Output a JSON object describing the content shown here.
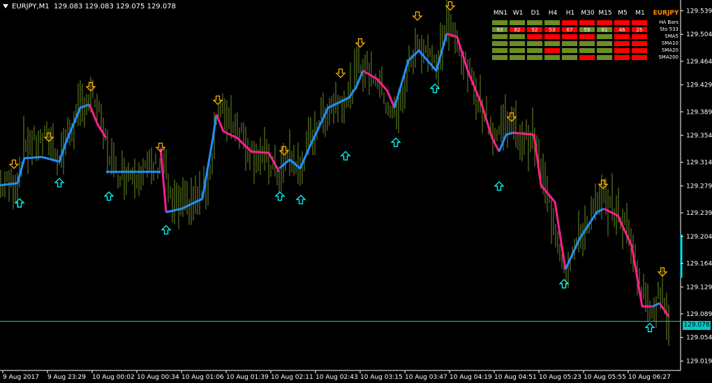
{
  "header": {
    "symbol": "EURJPY,M1",
    "ohlc": "129.083 129.083 129.075 129.078"
  },
  "current_price": "129.078",
  "colors": {
    "background": "#000000",
    "axis": "#ffffff",
    "bars": "#6b8e23",
    "uptrend": "#1e90ff",
    "downtrend": "#ff1f8f",
    "up_arrow": "#00ffff",
    "down_arrow": "#ffb000",
    "price_line": "#00cccc",
    "cell_green": "#6b8e23",
    "cell_red": "#ff0000",
    "symbol_label": "#ff8c00"
  },
  "mtf_table": {
    "timeframes": [
      "MN1",
      "W1",
      "D1",
      "H4",
      "H1",
      "M30",
      "M15",
      "M5",
      "M1"
    ],
    "symbol": "EURJPY",
    "rows": [
      {
        "label": "HA Bars",
        "cells": [
          {
            "c": "g"
          },
          {
            "c": "g"
          },
          {
            "c": "g"
          },
          {
            "c": "g"
          },
          {
            "c": "r"
          },
          {
            "c": "r"
          },
          {
            "c": "r"
          },
          {
            "c": "r"
          },
          {
            "c": "r"
          }
        ]
      },
      {
        "label": "Sto 533",
        "cells": [
          {
            "c": "g",
            "v": "93"
          },
          {
            "c": "r",
            "v": "82"
          },
          {
            "c": "r",
            "v": "52"
          },
          {
            "c": "r",
            "v": "53"
          },
          {
            "c": "r",
            "v": "67"
          },
          {
            "c": "g",
            "v": "59"
          },
          {
            "c": "g",
            "v": "81"
          },
          {
            "c": "r",
            "v": "46"
          },
          {
            "c": "r",
            "v": "25"
          }
        ]
      },
      {
        "label": "SMA5",
        "cells": [
          {
            "c": "g"
          },
          {
            "c": "g"
          },
          {
            "c": "r"
          },
          {
            "c": "r"
          },
          {
            "c": "r"
          },
          {
            "c": "r"
          },
          {
            "c": "g"
          },
          {
            "c": "r"
          },
          {
            "c": "r"
          }
        ]
      },
      {
        "label": "SMA10",
        "cells": [
          {
            "c": "g"
          },
          {
            "c": "g"
          },
          {
            "c": "g"
          },
          {
            "c": "g"
          },
          {
            "c": "g"
          },
          {
            "c": "g"
          },
          {
            "c": "g"
          },
          {
            "c": "r"
          },
          {
            "c": "r"
          }
        ]
      },
      {
        "label": "SMA20",
        "cells": [
          {
            "c": "g"
          },
          {
            "c": "g"
          },
          {
            "c": "g"
          },
          {
            "c": "r"
          },
          {
            "c": "g"
          },
          {
            "c": "g"
          },
          {
            "c": "g"
          },
          {
            "c": "r"
          },
          {
            "c": "r"
          }
        ]
      },
      {
        "label": "SMA200",
        "cells": [
          {
            "c": "g"
          },
          {
            "c": "g"
          },
          {
            "c": "g"
          },
          {
            "c": "g"
          },
          {
            "c": "g"
          },
          {
            "c": "r"
          },
          {
            "c": "g"
          },
          {
            "c": "r"
          },
          {
            "c": "r"
          }
        ]
      }
    ]
  },
  "chart_data": {
    "type": "line",
    "y_ticks": [
      "129.539",
      "129.504",
      "129.464",
      "129.429",
      "129.389",
      "129.354",
      "129.314",
      "129.279",
      "129.239",
      "129.204",
      "129.164",
      "129.129",
      "129.089",
      "129.054",
      "129.019"
    ],
    "x_ticks": [
      "9 Aug 2017",
      "9 Aug 23:29",
      "10 Aug 00:02",
      "10 Aug 00:34",
      "10 Aug 01:06",
      "10 Aug 01:39",
      "10 Aug 02:11",
      "10 Aug 02:43",
      "10 Aug 03:15",
      "10 Aug 03:47",
      "10 Aug 04:19",
      "10 Aug 04:51",
      "10 Aug 05:23",
      "10 Aug 05:55",
      "10 Aug 06:27"
    ],
    "ylim": [
      129.005,
      129.555
    ],
    "price_path": [
      [
        0,
        129.28
      ],
      [
        25,
        129.283
      ],
      [
        35,
        129.34
      ],
      [
        60,
        129.345
      ],
      [
        70,
        129.352
      ],
      [
        85,
        129.32
      ],
      [
        100,
        129.36
      ],
      [
        120,
        129.402
      ],
      [
        135,
        129.41
      ],
      [
        150,
        129.35
      ],
      [
        165,
        129.3
      ],
      [
        190,
        129.3
      ],
      [
        220,
        129.305
      ],
      [
        235,
        129.32
      ],
      [
        245,
        129.25
      ],
      [
        265,
        129.25
      ],
      [
        285,
        129.26
      ],
      [
        300,
        129.29
      ],
      [
        310,
        129.38
      ],
      [
        320,
        129.39
      ],
      [
        340,
        129.37
      ],
      [
        360,
        129.33
      ],
      [
        380,
        129.32
      ],
      [
        400,
        129.295
      ],
      [
        415,
        129.325
      ],
      [
        430,
        129.3
      ],
      [
        445,
        129.35
      ],
      [
        460,
        129.38
      ],
      [
        480,
        129.405
      ],
      [
        500,
        129.41
      ],
      [
        515,
        129.46
      ],
      [
        540,
        129.44
      ],
      [
        555,
        129.4
      ],
      [
        570,
        129.38
      ],
      [
        585,
        129.455
      ],
      [
        600,
        129.49
      ],
      [
        615,
        129.48
      ],
      [
        625,
        129.45
      ],
      [
        640,
        129.52
      ],
      [
        655,
        129.49
      ],
      [
        670,
        129.45
      ],
      [
        690,
        129.4
      ],
      [
        710,
        129.35
      ],
      [
        725,
        129.38
      ],
      [
        745,
        129.35
      ],
      [
        765,
        129.35
      ],
      [
        780,
        129.28
      ],
      [
        795,
        129.22
      ],
      [
        810,
        129.155
      ],
      [
        830,
        129.2
      ],
      [
        850,
        129.24
      ],
      [
        865,
        129.26
      ],
      [
        885,
        129.24
      ],
      [
        905,
        129.2
      ],
      [
        920,
        129.12
      ],
      [
        935,
        129.1
      ],
      [
        950,
        129.12
      ],
      [
        958,
        129.085
      ]
    ],
    "supertrend": [
      {
        "trend": "up",
        "points": [
          [
            0,
            129.28
          ],
          [
            25,
            129.283
          ],
          [
            35,
            129.32
          ],
          [
            60,
            129.322
          ],
          [
            85,
            129.315
          ],
          [
            95,
            129.345
          ],
          [
            115,
            129.395
          ],
          [
            128,
            129.4
          ]
        ]
      },
      {
        "trend": "down",
        "points": [
          [
            128,
            129.4
          ],
          [
            140,
            129.37
          ],
          [
            152,
            129.35
          ]
        ]
      },
      {
        "trend": "up",
        "points": [
          [
            152,
            129.3
          ],
          [
            230,
            129.3
          ]
        ]
      },
      {
        "trend": "down",
        "points": [
          [
            230,
            129.335
          ],
          [
            238,
            129.24
          ]
        ]
      },
      {
        "trend": "up",
        "points": [
          [
            238,
            129.24
          ],
          [
            260,
            129.245
          ],
          [
            290,
            129.26
          ],
          [
            305,
            129.35
          ],
          [
            310,
            129.385
          ]
        ]
      },
      {
        "trend": "down",
        "points": [
          [
            310,
            129.385
          ],
          [
            320,
            129.36
          ],
          [
            340,
            129.35
          ],
          [
            360,
            129.33
          ],
          [
            385,
            129.328
          ],
          [
            400,
            129.3
          ]
        ]
      },
      {
        "trend": "up",
        "points": [
          [
            400,
            129.305
          ],
          [
            415,
            129.318
          ],
          [
            430,
            129.305
          ],
          [
            445,
            129.34
          ],
          [
            470,
            129.395
          ],
          [
            490,
            129.405
          ],
          [
            500,
            129.41
          ],
          [
            510,
            129.425
          ],
          [
            520,
            129.45
          ]
        ]
      },
      {
        "trend": "down",
        "points": [
          [
            520,
            129.45
          ],
          [
            540,
            129.438
          ],
          [
            555,
            129.42
          ],
          [
            565,
            129.395
          ]
        ]
      },
      {
        "trend": "up",
        "points": [
          [
            565,
            129.395
          ],
          [
            585,
            129.465
          ],
          [
            600,
            129.48
          ],
          [
            625,
            129.45
          ],
          [
            640,
            129.505
          ]
        ]
      },
      {
        "trend": "down",
        "points": [
          [
            640,
            129.505
          ],
          [
            655,
            129.5
          ],
          [
            670,
            129.45
          ],
          [
            690,
            129.4
          ],
          [
            705,
            129.35
          ],
          [
            715,
            129.33
          ]
        ]
      },
      {
        "trend": "up",
        "points": [
          [
            715,
            129.33
          ],
          [
            725,
            129.355
          ],
          [
            735,
            129.358
          ]
        ]
      },
      {
        "trend": "down",
        "points": [
          [
            735,
            129.358
          ],
          [
            765,
            129.355
          ],
          [
            775,
            129.28
          ],
          [
            795,
            129.255
          ],
          [
            810,
            129.155
          ]
        ]
      },
      {
        "trend": "up",
        "points": [
          [
            810,
            129.155
          ],
          [
            830,
            129.2
          ],
          [
            855,
            129.24
          ],
          [
            865,
            129.245
          ]
        ]
      },
      {
        "trend": "down",
        "points": [
          [
            865,
            129.245
          ],
          [
            885,
            129.235
          ],
          [
            905,
            129.19
          ],
          [
            920,
            129.1
          ],
          [
            935,
            129.1
          ]
        ]
      },
      {
        "trend": "up",
        "points": [
          [
            935,
            129.1
          ],
          [
            945,
            129.105
          ]
        ]
      },
      {
        "trend": "down",
        "points": [
          [
            945,
            129.105
          ],
          [
            958,
            129.085
          ]
        ]
      }
    ],
    "up_signals": [
      [
        28,
        129.26
      ],
      [
        85,
        129.29
      ],
      [
        156,
        129.27
      ],
      [
        238,
        129.22
      ],
      [
        401,
        129.27
      ],
      [
        431,
        129.265
      ],
      [
        495,
        129.33
      ],
      [
        567,
        129.35
      ],
      [
        623,
        129.43
      ],
      [
        715,
        129.285
      ],
      [
        808,
        129.14
      ],
      [
        931,
        129.075
      ]
    ],
    "down_signals": [
      [
        20,
        129.305
      ],
      [
        70,
        129.345
      ],
      [
        130,
        129.42
      ],
      [
        230,
        129.33
      ],
      [
        312,
        129.4
      ],
      [
        407,
        129.325
      ],
      [
        488,
        129.44
      ],
      [
        516,
        129.485
      ],
      [
        598,
        129.525
      ],
      [
        645,
        129.54
      ],
      [
        733,
        129.375
      ],
      [
        864,
        129.275
      ],
      [
        949,
        129.145
      ]
    ],
    "current_price_value": 129.078
  }
}
